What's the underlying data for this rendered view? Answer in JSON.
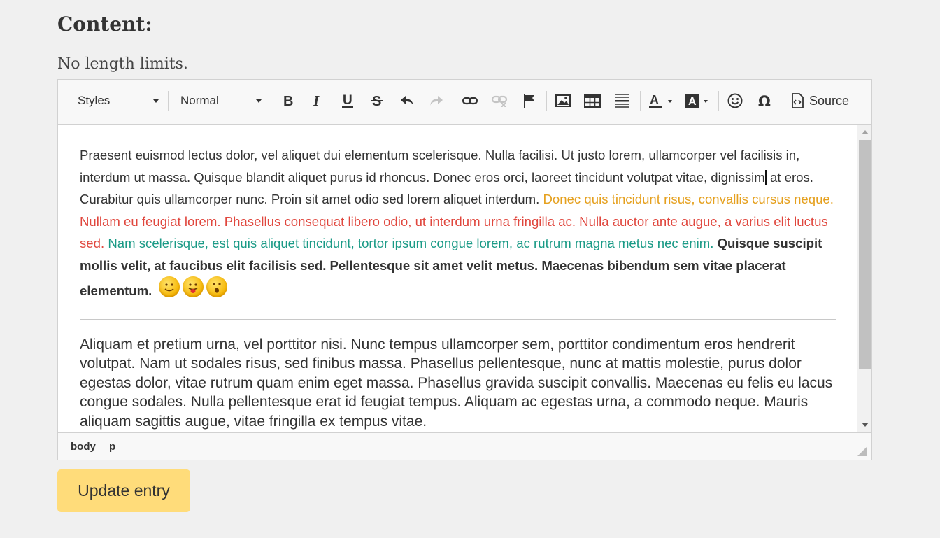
{
  "form": {
    "label": "Content:",
    "hint": "No length limits.",
    "submit_label": "Update entry"
  },
  "toolbar": {
    "styles_combo": "Styles",
    "format_combo": "Normal",
    "buttons": [
      {
        "name": "bold",
        "icon": "bold-icon"
      },
      {
        "name": "italic",
        "icon": "italic-icon"
      },
      {
        "name": "underline",
        "icon": "underline-icon"
      },
      {
        "name": "strikethrough",
        "icon": "strikethrough-icon"
      },
      {
        "name": "undo",
        "icon": "undo-icon"
      },
      {
        "name": "redo",
        "icon": "redo-icon",
        "disabled": true
      },
      {
        "name": "link",
        "icon": "link-icon"
      },
      {
        "name": "unlink",
        "icon": "unlink-icon",
        "disabled": true
      },
      {
        "name": "anchor",
        "icon": "flag-icon"
      },
      {
        "name": "image",
        "icon": "image-icon"
      },
      {
        "name": "table",
        "icon": "table-icon"
      },
      {
        "name": "horizontal-line",
        "icon": "horizontal-line-icon"
      },
      {
        "name": "text-color",
        "icon": "text-color-icon"
      },
      {
        "name": "background-color",
        "icon": "background-color-icon"
      },
      {
        "name": "smiley",
        "icon": "smiley-icon"
      },
      {
        "name": "special-char",
        "icon": "omega-icon"
      }
    ],
    "source_label": "Source"
  },
  "content": {
    "para1_plain": "Praesent euismod lectus dolor, vel aliquet dui elementum scelerisque. Nulla facilisi. Ut justo lorem, ullamcorper vel facilisis in, interdum ut massa. Quisque blandit aliquet purus id rhoncus. Donec eros orci, laoreet tincidunt volutpat vitae, dignissim",
    "para1_plain_b": " at eros. Curabitur quis ullamcorper nunc. Proin sit amet odio sed lorem aliquet interdum. ",
    "para1_orange": "Donec quis tincidunt risus, convallis cursus neque.",
    "para1_red": " Nullam eu feugiat lorem. Phasellus consequat libero odio, ut interdum urna fringilla ac. Nulla auctor ante augue, a varius elit luctus sed.",
    "para1_teal": " Nam scelerisque, est quis aliquet tincidunt, tortor ipsum congue lorem, ac rutrum magna metus nec enim.",
    "para1_bold": " Quisque suscipit mollis velit, at faucibus elit facilisis sed. Pellentesque sit amet velit metus. Maecenas bibendum sem vitae placerat elementum.",
    "emojis": [
      "smile-emoji",
      "tongue-emoji",
      "surprised-emoji"
    ],
    "para2": "Aliquam et pretium urna, vel porttitor nisi. Nunc tempus ullamcorper sem, porttitor condimentum eros hendrerit volutpat. Nam ut sodales risus, sed finibus massa. Phasellus pellentesque, nunc at mattis molestie, purus dolor egestas dolor, vitae rutrum quam enim eget massa. Phasellus gravida suscipit convallis. Maecenas eu felis eu lacus congue sodales. Nulla pellentesque erat id feugiat tempus. Aliquam ac egestas urna, a commodo neque. Mauris aliquam sagittis augue, vitae fringilla ex tempus vitae."
  },
  "statusbar": {
    "path": [
      "body",
      "p"
    ]
  },
  "colors": {
    "orange": "#e5a01e",
    "red": "#e0473e",
    "teal": "#1a9a86",
    "button": "#ffdc7a"
  }
}
